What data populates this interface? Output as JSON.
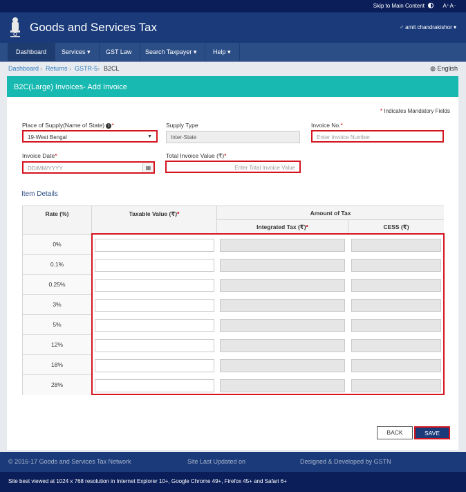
{
  "top_strip": {
    "skip_link": "Skip to Main Content",
    "font_increase": "A⁺",
    "font_decrease": "A⁻"
  },
  "header": {
    "title": "Goods and Services Tax",
    "user": "♂ amit chandrakishor ▾"
  },
  "nav": {
    "dashboard": "Dashboard",
    "services": "Services ▾",
    "gst_law": "GST Law",
    "search_taxpayer": "Search Taxpayer ▾",
    "help": "Help ▾"
  },
  "breadcrumb": {
    "items": [
      "Dashboard",
      "Returns",
      "GSTR-5",
      "B2CL"
    ],
    "language": "English"
  },
  "page": {
    "title": "B2C(Large) Invoices- Add Invoice",
    "mandatory_note": "Indicates Mandatory Fields"
  },
  "form": {
    "place_of_supply_label": "Place of Supply(Name of State)",
    "place_of_supply_value": "19-West Bengal",
    "supply_type_label": "Supply Type",
    "supply_type_value": "Inter-State",
    "invoice_no_label": "Invoice No.",
    "invoice_no_placeholder": "Enter Invoice Number",
    "invoice_date_label": "Invoice Date",
    "invoice_date_placeholder": "DD/MM/YYYY",
    "total_value_label": "Total Invoice Value (₹)",
    "total_value_placeholder": "Enter Total Invoice Value"
  },
  "items": {
    "heading": "Item Details",
    "col_rate": "Rate (%)",
    "col_taxable": "Taxable Value (₹)",
    "col_amount": "Amount of Tax",
    "col_igst": "Integrated Tax (₹)",
    "col_cess": "CESS (₹)",
    "rates": [
      "0%",
      "0.1%",
      "0.25%",
      "3%",
      "5%",
      "12%",
      "18%",
      "28%"
    ]
  },
  "buttons": {
    "back": "BACK",
    "save": "SAVE"
  },
  "footer": {
    "copyright": "© 2016-17 Goods and Services Tax Network",
    "updated": "Site Last Updated on",
    "designed": "Designed & Developed by GSTN",
    "browser_note": "Site best viewed at 1024 x 768 resolution in Internet Explorer 10+, Google Chrome 49+, Firefox 45+ and Safari 6+"
  }
}
